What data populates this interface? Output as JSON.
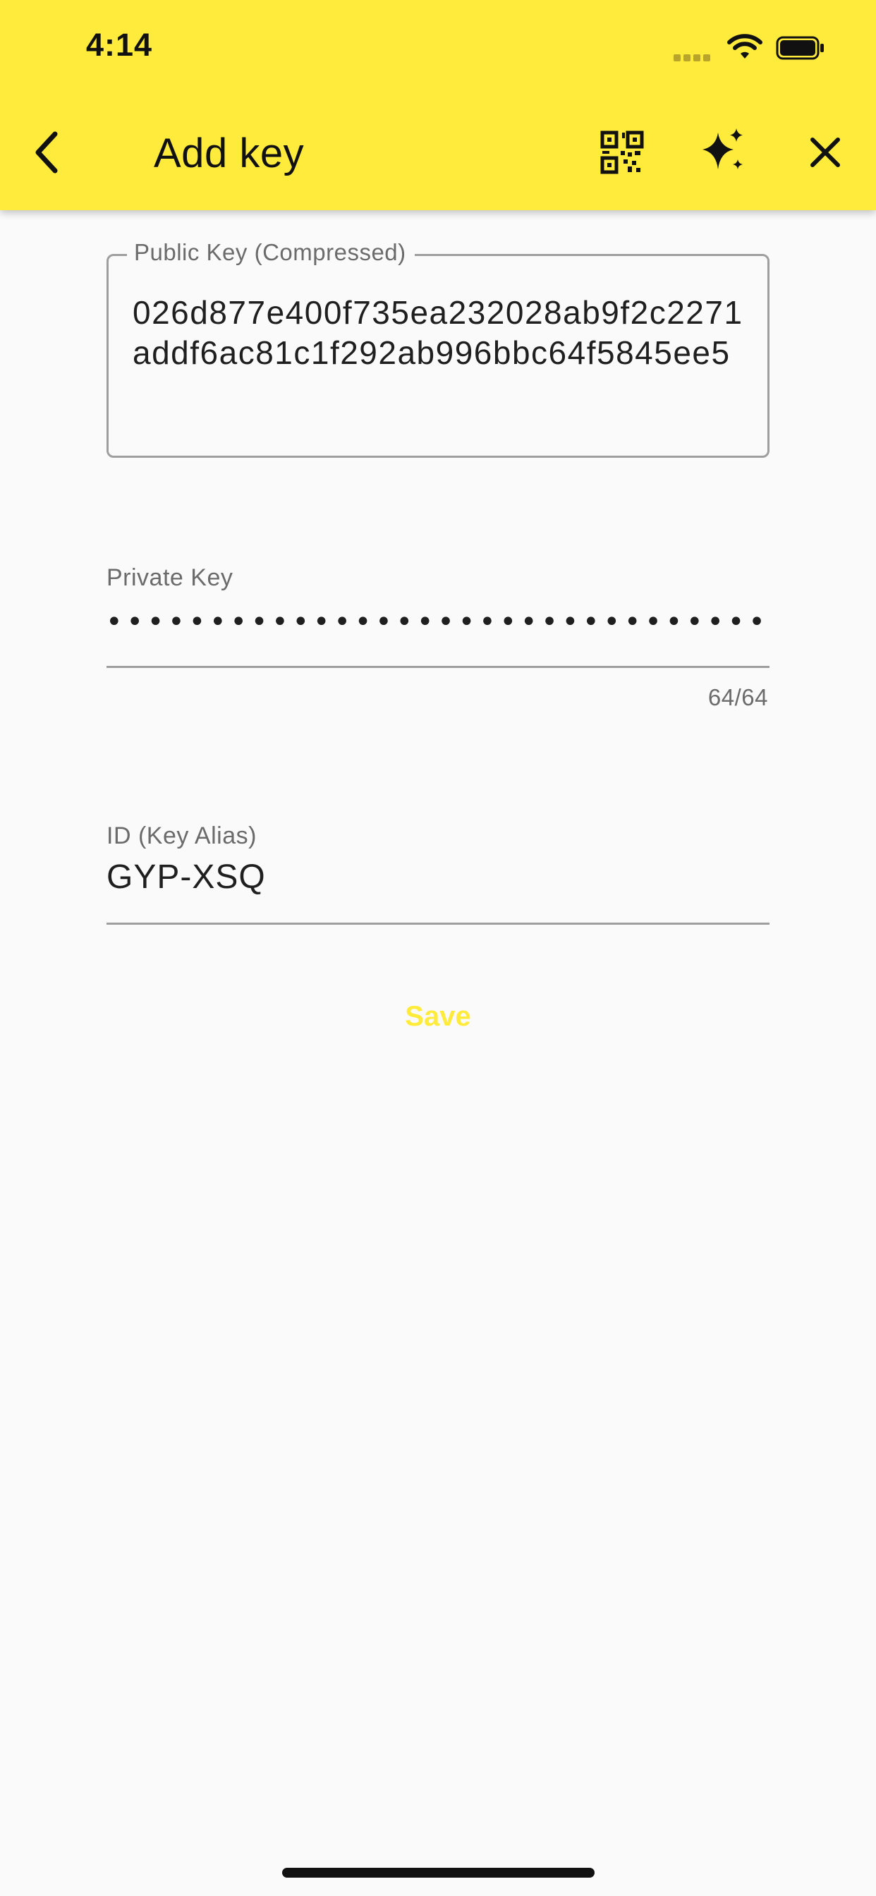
{
  "status_bar": {
    "time": "4:14"
  },
  "app_bar": {
    "title": "Add key",
    "icons": [
      "back-arrow-icon",
      "qr-code-icon",
      "sparkle-icon",
      "close-icon"
    ],
    "background_color": "#ffeb3b"
  },
  "form": {
    "public_key": {
      "label": "Public Key (Compressed)",
      "value": "026d877e400f735ea232028ab9f2c2271addf6ac81c1f292ab996bbc64f5845ee5"
    },
    "private_key": {
      "label": "Private Key",
      "masked_value": "••••••••••••••••••••••••••••••••••••••••••••••••••••••••••••••••",
      "counter": "64/64"
    },
    "id": {
      "label": "ID (Key Alias)",
      "value": "GYP-XSQ"
    },
    "save_label": "Save",
    "accent_color": "#ffeb3b"
  }
}
